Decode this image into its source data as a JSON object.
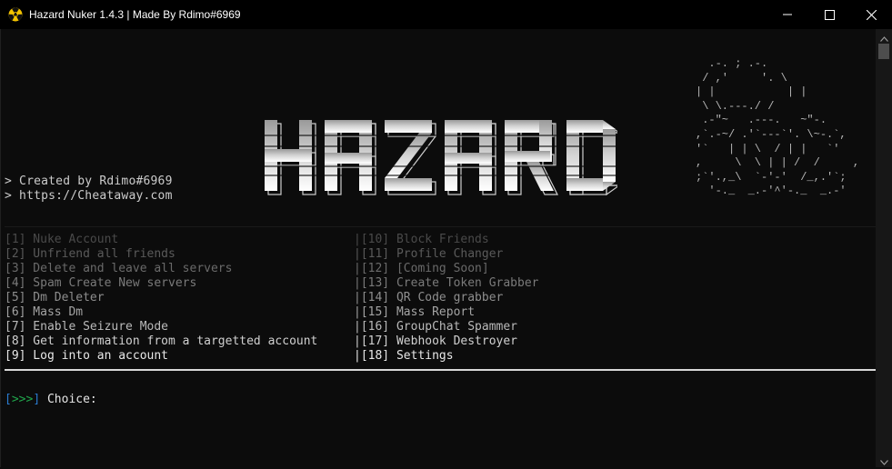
{
  "window": {
    "title": "Hazard Nuker 1.4.3 | Made By Rdimo#6969",
    "icon": "radiation-icon",
    "buttons": [
      "minimize-icon",
      "maximize-icon",
      "close-icon"
    ]
  },
  "banner": {
    "logo_text": "HAZARD",
    "credits": [
      "> Created by Rdimo#6969",
      "> https://Cheataway.com"
    ],
    "ascii_art": "  .-. ; .-.\n / ,'     '. \\\n| |           | |\n \\ \\.---./ /\n .-\"~   .---.   ~\"-.\n,`.-~/ .'`---`'. \\~-.`,\n'`   | | \\  / | |   `'\n,     \\  \\ | | /  /     ,\n;`'.,_\\  `-'-'  /_,.'`;\n  '-._  _.-'^'-._  _.-'"
  },
  "menu": {
    "left": [
      {
        "text": "[1] Nuke Account",
        "color": "#4a4a4a"
      },
      {
        "text": "[2] Unfriend all friends",
        "color": "#5a5a5a"
      },
      {
        "text": "[3] Delete and leave all servers",
        "color": "#6a6a6a"
      },
      {
        "text": "[4] Spam Create New servers",
        "color": "#7a7a7a"
      },
      {
        "text": "[5] Dm Deleter",
        "color": "#8e8e8e"
      },
      {
        "text": "[6] Mass Dm",
        "color": "#a4a4a4"
      },
      {
        "text": "[7] Enable Seizure Mode",
        "color": "#bababa"
      },
      {
        "text": "[8] Get information from a targetted account",
        "color": "#d0d0d0"
      },
      {
        "text": "[9] Log into an account",
        "color": "#e8e8e8"
      }
    ],
    "right": [
      {
        "text": "|[10] Block Friends",
        "color": "#4a4a4a"
      },
      {
        "text": "|[11] Profile Changer",
        "color": "#5a5a5a"
      },
      {
        "text": "|[12] [Coming Soon]",
        "color": "#6a6a6a"
      },
      {
        "text": "|[13] Create Token Grabber",
        "color": "#7a7a7a"
      },
      {
        "text": "|[14] QR Code grabber",
        "color": "#8e8e8e"
      },
      {
        "text": "|[15] Mass Report",
        "color": "#a4a4a4"
      },
      {
        "text": "|[16] GroupChat Spammer",
        "color": "#bababa"
      },
      {
        "text": "|[17] Webhook Destroyer",
        "color": "#d0d0d0"
      },
      {
        "text": "|[18] Settings",
        "color": "#e8e8e8"
      }
    ]
  },
  "prompt": {
    "open": "[",
    "arrows": ">>>",
    "close": "]",
    "label": " Choice:",
    "colors": {
      "brackets": "#2a7cd1",
      "arrows": "#20a74c"
    }
  }
}
